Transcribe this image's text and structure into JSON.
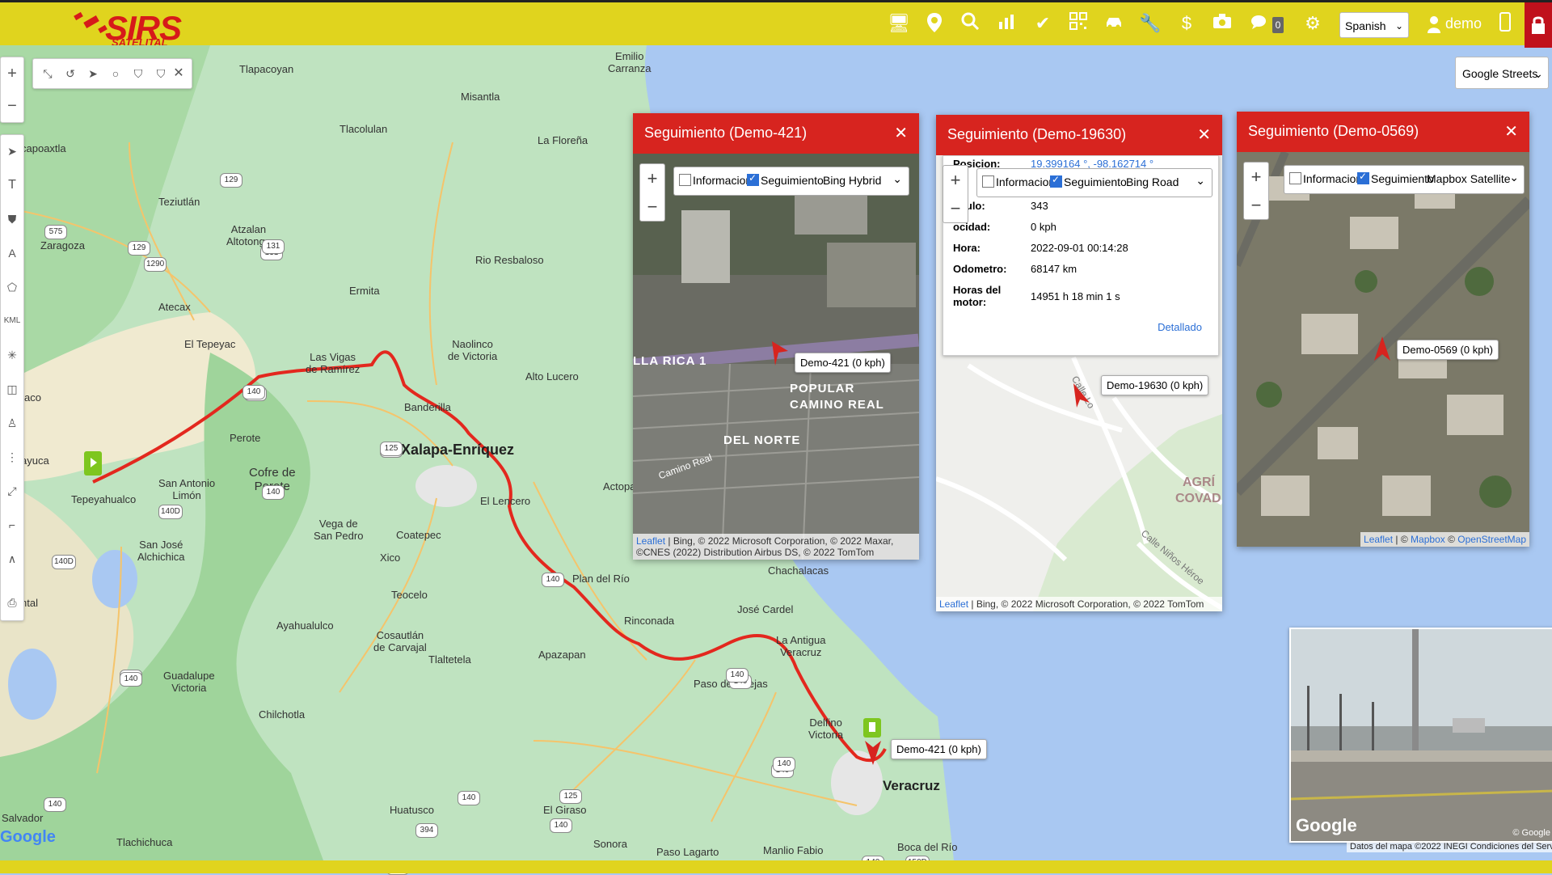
{
  "app": {
    "logo_text": "SIRS",
    "logo_sub": "SATELITAL"
  },
  "topbar": {
    "icons": [
      "monitor-icon",
      "location-pin-icon",
      "search-icon",
      "chart-icon",
      "check-icon",
      "qr-code-icon",
      "car-icon",
      "wrench-icon",
      "dollar-icon",
      "camera-icon",
      "chat-icon",
      "gear-icon",
      "phone-icon",
      "lock-icon"
    ],
    "chat_count": "0",
    "language": "Spanish",
    "user": "demo"
  },
  "basemap": {
    "selected": "Google Streets"
  },
  "places": [
    {
      "name": "Tlapacoyan"
    },
    {
      "name": "Emilio\nCarranza"
    },
    {
      "name": "Misantla"
    },
    {
      "name": "Tlacolulan"
    },
    {
      "name": "La Floreña"
    },
    {
      "name": "Teziutlán"
    },
    {
      "name": "Atzalan\nAltotonga"
    },
    {
      "name": "Zaragoza"
    },
    {
      "name": "Rio Resbaloso"
    },
    {
      "name": "Ermita"
    },
    {
      "name": "Atecax"
    },
    {
      "name": "El Tepeyac"
    },
    {
      "name": "Las Vigas\nde Ramírez"
    },
    {
      "name": "Naolinco\nde Victoria"
    },
    {
      "name": "Alto Lucero"
    },
    {
      "name": "Banderilla"
    },
    {
      "name": "Perote"
    },
    {
      "name": "Xalapa-Enríquez"
    },
    {
      "name": "Cofre de\nPerote"
    },
    {
      "name": "San Antonio\nLimón"
    },
    {
      "name": "Tepeyahualco"
    },
    {
      "name": "El Lencero"
    },
    {
      "name": "Actopa"
    },
    {
      "name": "San José\nAlchichica"
    },
    {
      "name": "Vega de\nSan Pedro"
    },
    {
      "name": "Coatepec"
    },
    {
      "name": "Xico"
    },
    {
      "name": "Plan del Río"
    },
    {
      "name": "Teocelo"
    },
    {
      "name": "Chachalacas"
    },
    {
      "name": "Rinconada"
    },
    {
      "name": "José Cardel"
    },
    {
      "name": "Ayahualulco"
    },
    {
      "name": "Cosautlán\nde Carvajal"
    },
    {
      "name": "Tlaltetela"
    },
    {
      "name": "Apazapan"
    },
    {
      "name": "La Antigua\nVeracruz"
    },
    {
      "name": "Guadalupe\nVictoria"
    },
    {
      "name": "Paso de Ovejas"
    },
    {
      "name": "Chilchotla"
    },
    {
      "name": "Delfino\nVictoria"
    },
    {
      "name": "Veracruz"
    },
    {
      "name": "Huatusco"
    },
    {
      "name": "El Giraso"
    },
    {
      "name": "Salvador"
    },
    {
      "name": "Tlachichuca"
    },
    {
      "name": "Sonora"
    },
    {
      "name": "Paso Lagarto"
    },
    {
      "name": "Manlio Fabio"
    },
    {
      "name": "Boca del Río"
    },
    {
      "name": "capoaxtla"
    },
    {
      "name": "ayuca"
    },
    {
      "name": "aco"
    },
    {
      "name": "ntal"
    }
  ],
  "route_marker": {
    "label": "Demo-421 (0 kph)"
  },
  "popups": [
    {
      "title": "Seguimiento (Demo-421)",
      "info_label": "Informacion",
      "track_label": "Seguimiento",
      "layer": "Bing Hybrid",
      "marker_label": "Demo-421 (0 kph)",
      "streets": [
        "LLA RICA 1",
        "POPULAR",
        "CAMINO REAL",
        "DEL NORTE",
        "Camino Real"
      ],
      "attribution_link": "Leaflet",
      "attribution": "| Bing, © 2022 Microsoft Corporation, © 2022 Maxar, ©CNES (2022) Distribution Airbus DS, © 2022 TomTom"
    },
    {
      "title": "Seguimiento (Demo-19630)",
      "info_label": "Informacion",
      "track_label": "Seguimiento",
      "layer": "Bing Road",
      "marker_label": "Demo-19630 (0 kph)",
      "info": {
        "posicion_k": "Posicion:",
        "posicion_v": "19.399164 °, -98.162714 °",
        "angulo_k": "ngulo:",
        "angulo_v": "343",
        "velocidad_k": "ocidad:",
        "velocidad_v": "0 kph",
        "hora_k": "Hora:",
        "hora_v": "2022-09-01 00:14:28",
        "odometro_k": "Odometro:",
        "odometro_v": "68147 km",
        "horas_k": "Horas del motor:",
        "horas_v": "14951 h 18 min 1 s",
        "detail": "Detallado"
      },
      "streets": [
        "AGRÍ",
        "COVAD",
        "Calle Niños Héroe",
        "Calle Lo"
      ],
      "attribution_link": "Leaflet",
      "attribution": "| Bing, © 2022 Microsoft Corporation, © 2022 TomTom"
    },
    {
      "title": "Seguimiento (Demo-0569)",
      "info_label": "Informacion",
      "track_label": "Seguimiento",
      "layer": "Mapbox Satellite",
      "marker_label": "Demo-0569 (0 kph)",
      "attribution_link": "Leaflet",
      "attribution_mid": "| ©",
      "attribution_mapbox": "Mapbox",
      "attribution_sep": "©",
      "attribution_osm": "OpenStreetMap"
    }
  ],
  "streetview": {
    "brand": "Google",
    "copyright": "© Google"
  },
  "map_credits": "Datos del mapa ©2022 INEGI   Condiciones del Servicio",
  "google_logo": "Google",
  "highways": [
    "129",
    "575",
    "131",
    "1290",
    "129",
    "131",
    "140",
    "140",
    "140D",
    "140D",
    "140",
    "140",
    "140",
    "140",
    "140",
    "140",
    "150D",
    "180",
    "394",
    "125",
    "125",
    "140",
    "140",
    "140",
    "140",
    "140",
    "140",
    "140"
  ]
}
